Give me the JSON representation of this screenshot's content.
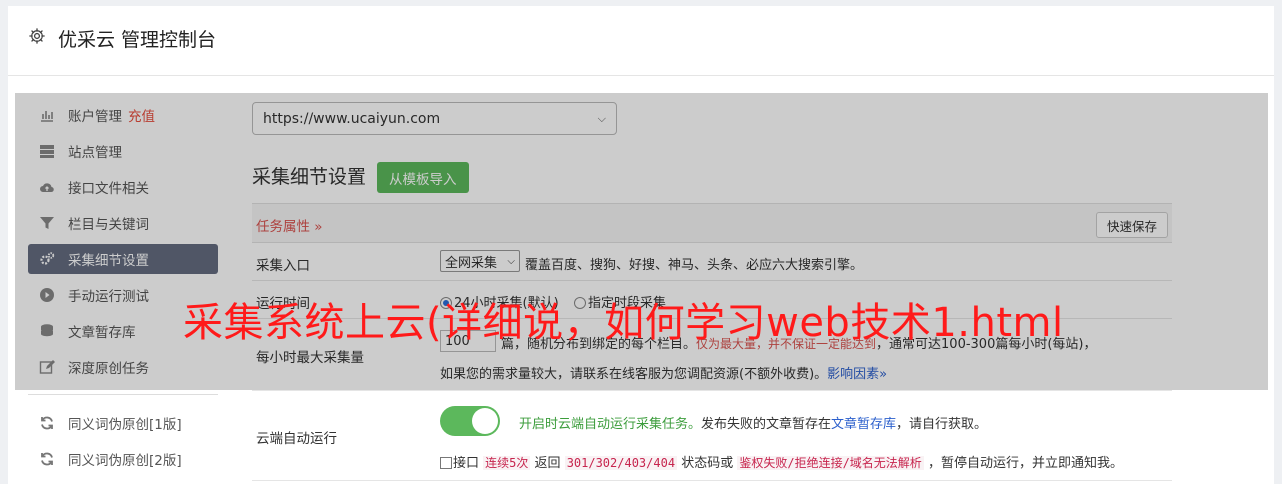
{
  "header": {
    "title": "优采云 管理控制台"
  },
  "sidebar": {
    "items": [
      {
        "label": "账户管理",
        "extra": "充值"
      },
      {
        "label": "站点管理"
      },
      {
        "label": "接口文件相关"
      },
      {
        "label": "栏目与关键词"
      },
      {
        "label": "采集细节设置"
      },
      {
        "label": "手动运行测试"
      },
      {
        "label": "文章暂存库"
      },
      {
        "label": "深度原创任务"
      },
      {
        "label": "同义词伪原创[1版]"
      },
      {
        "label": "同义词伪原创[2版]"
      }
    ]
  },
  "site_select": {
    "value": "https://www.ucaiyun.com"
  },
  "section": {
    "title": "采集细节设置",
    "import_button": "从模板导入"
  },
  "task": {
    "label": "任务属性 »",
    "quick_save": "快速保存"
  },
  "form": {
    "entry": {
      "label": "采集入口",
      "select_value": "全网采集",
      "desc": "覆盖百度、搜狗、好搜、神马、头条、必应六大搜索引擎。"
    },
    "runtime": {
      "label": "运行时间",
      "option1": "24小时采集(默认)",
      "option2": "指定时段采集"
    },
    "max": {
      "label": "每小时最大采集量",
      "value": "100",
      "line1_a": "篇，随机分布到绑定的每个栏目。",
      "line1_red": "仅为最大量，并不保证一定能达到",
      "line1_b": "，通常可达100-300篇每小时(每站)，",
      "line2": "如果您的需求量较大，请联系在线客服为您调配资源(不额外收费)。",
      "line2_link": "影响因素»"
    },
    "cloud": {
      "label": "云端自动运行",
      "green": "开启时云端自动运行采集任务。",
      "text": "发布失败的文章暂存在",
      "link": "文章暂存库",
      "text2": "，请自行获取。",
      "cb_label": "接口",
      "m1": "连续5次",
      "t1": "返回",
      "m2": "301/302/403/404",
      "t2": "状态码或",
      "m3": "鉴权失败/拒绝连接/域名无法解析",
      "t3": "，暂停自动运行，并立即通知我。"
    }
  },
  "watermark": {
    "text": "采集系统上云(详细说，如何学习web技术1.html"
  }
}
